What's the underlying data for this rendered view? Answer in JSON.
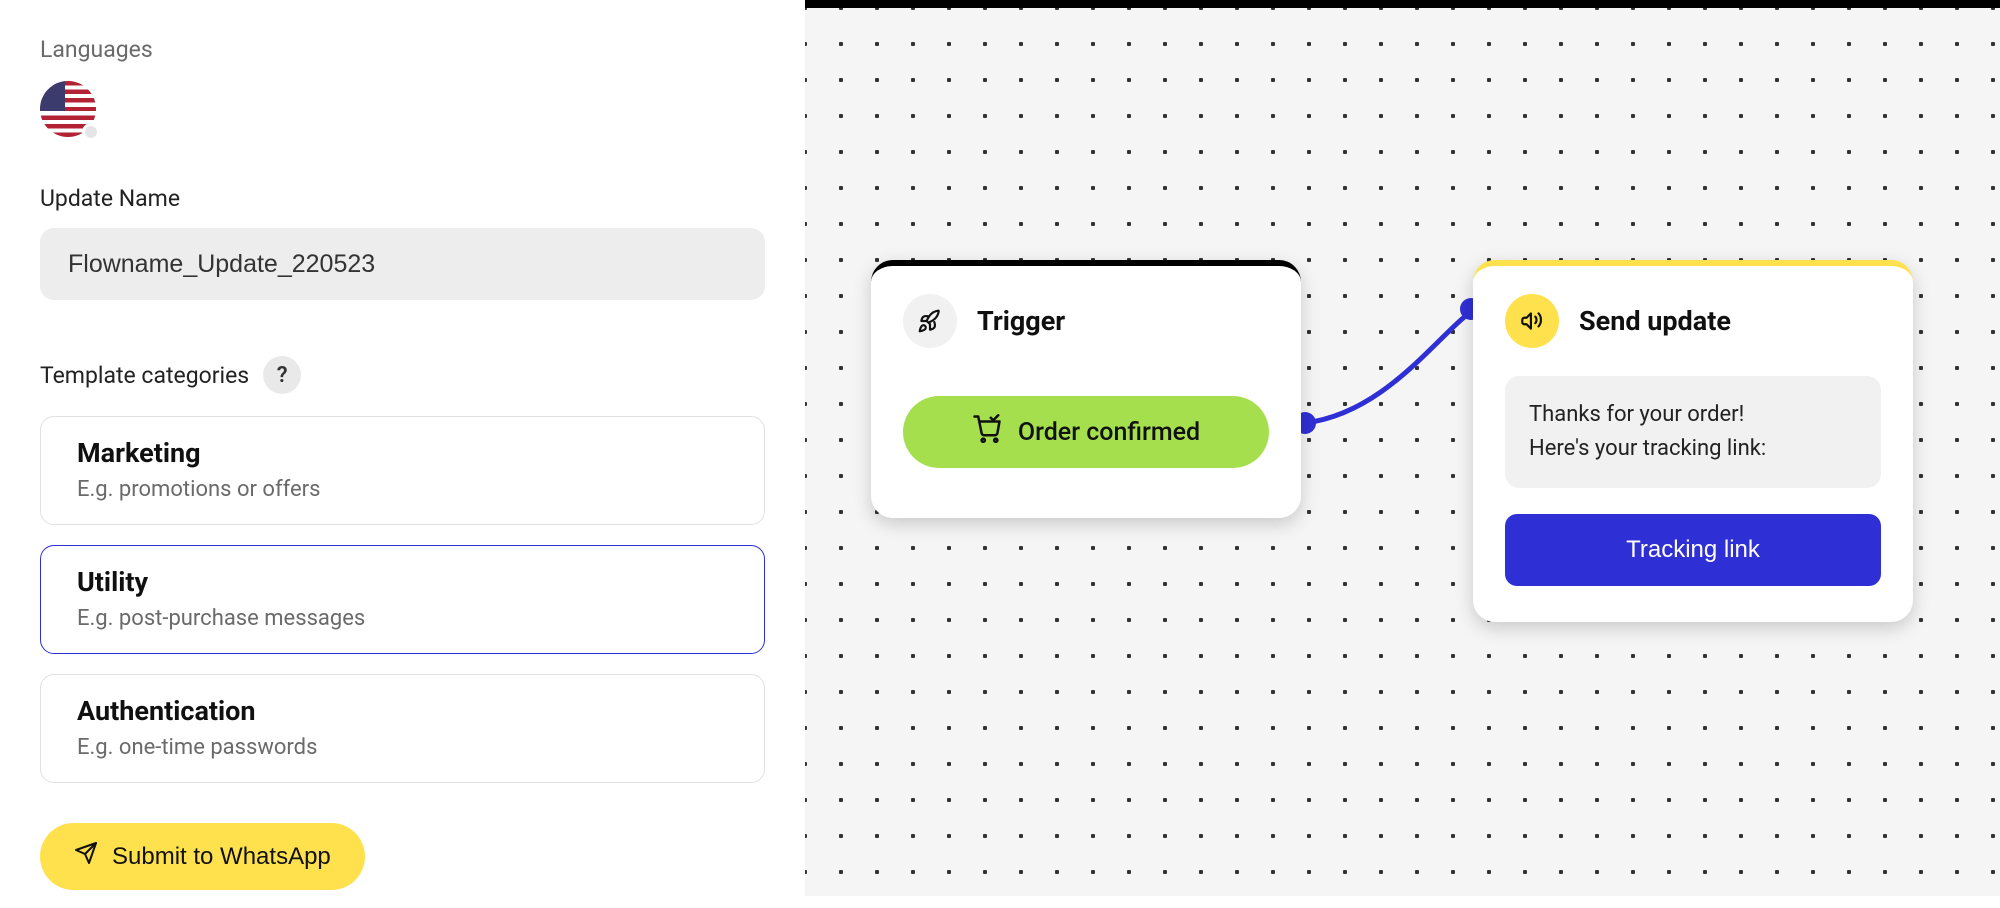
{
  "sidebar": {
    "languages_label": "Languages",
    "update_name_label": "Update Name",
    "update_name_value": "Flowname_Update_220523",
    "template_categories_label": "Template categories",
    "help_symbol": "?",
    "categories": [
      {
        "title": "Marketing",
        "desc": "E.g. promotions or offers",
        "selected": false
      },
      {
        "title": "Utility",
        "desc": "E.g. post-purchase messages",
        "selected": true
      },
      {
        "title": "Authentication",
        "desc": "E.g. one-time passwords",
        "selected": false
      }
    ],
    "submit_label": "Submit to WhatsApp"
  },
  "canvas": {
    "trigger": {
      "title": "Trigger",
      "pill_label": "Order confirmed"
    },
    "send": {
      "title": "Send update",
      "message_line1": "Thanks for your order!",
      "message_line2": "Here's your tracking link:",
      "button_label": "Tracking link"
    }
  }
}
